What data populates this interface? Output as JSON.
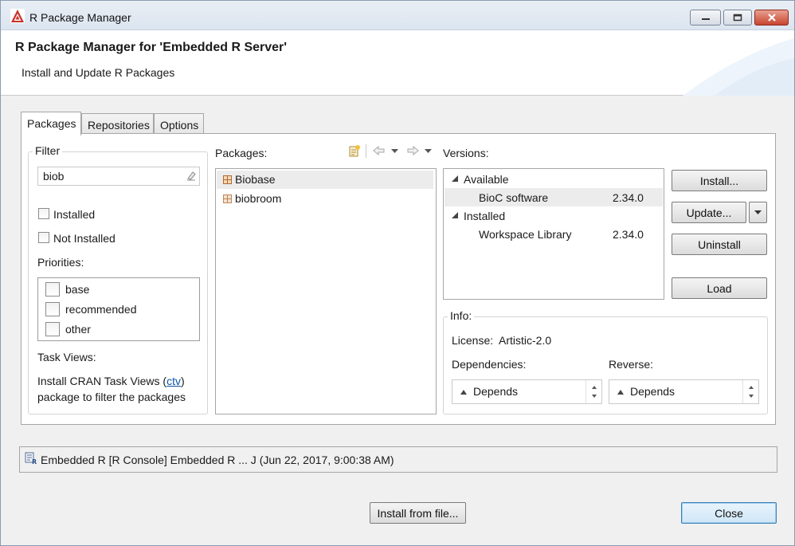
{
  "window": {
    "title": "R Package Manager"
  },
  "header": {
    "title": "R Package Manager for 'Embedded R Server'",
    "subtitle": "Install and Update R Packages"
  },
  "tabs": [
    {
      "label": "Packages",
      "active": true
    },
    {
      "label": "Repositories",
      "active": false
    },
    {
      "label": "Options",
      "active": false
    }
  ],
  "filter": {
    "legend": "Filter",
    "search_value": "biob",
    "installed_label": "Installed",
    "not_installed_label": "Not Installed",
    "priorities_label": "Priorities:",
    "priorities": [
      "base",
      "recommended",
      "other"
    ],
    "task_views_label": "Task Views:",
    "task_views_text_1": "Install CRAN Task Views (",
    "task_views_link": "ctv",
    "task_views_text_2": ")",
    "task_views_text_3": "package to filter the packages"
  },
  "packages": {
    "label": "Packages:",
    "items": [
      {
        "name": "Biobase",
        "selected": true
      },
      {
        "name": "biobroom",
        "selected": false
      }
    ]
  },
  "versions": {
    "label": "Versions:",
    "groups": [
      {
        "name": "Available",
        "entries": [
          {
            "source": "BioC software",
            "version": "2.34.0",
            "selected": true
          }
        ]
      },
      {
        "name": "Installed",
        "entries": [
          {
            "source": "Workspace Library",
            "version": "2.34.0",
            "selected": false
          }
        ]
      }
    ]
  },
  "actions": {
    "install": "Install...",
    "update": "Update...",
    "uninstall": "Uninstall",
    "load": "Load"
  },
  "info": {
    "legend": "Info:",
    "license_label": "License:",
    "license_value": "Artistic-2.0",
    "dependencies_label": "Dependencies:",
    "reverse_label": "Reverse:",
    "dependencies_value": "Depends",
    "reverse_value": "Depends"
  },
  "status": {
    "text": "Embedded R [R Console] Embedded R  ... J (Jun 22, 2017, 9:00:38 AM)"
  },
  "footer": {
    "install_from_file": "Install from file...",
    "close": "Close"
  },
  "colors": {
    "accent": "#3c7fb1",
    "link": "#0b53a6",
    "selection": "#ececec"
  }
}
